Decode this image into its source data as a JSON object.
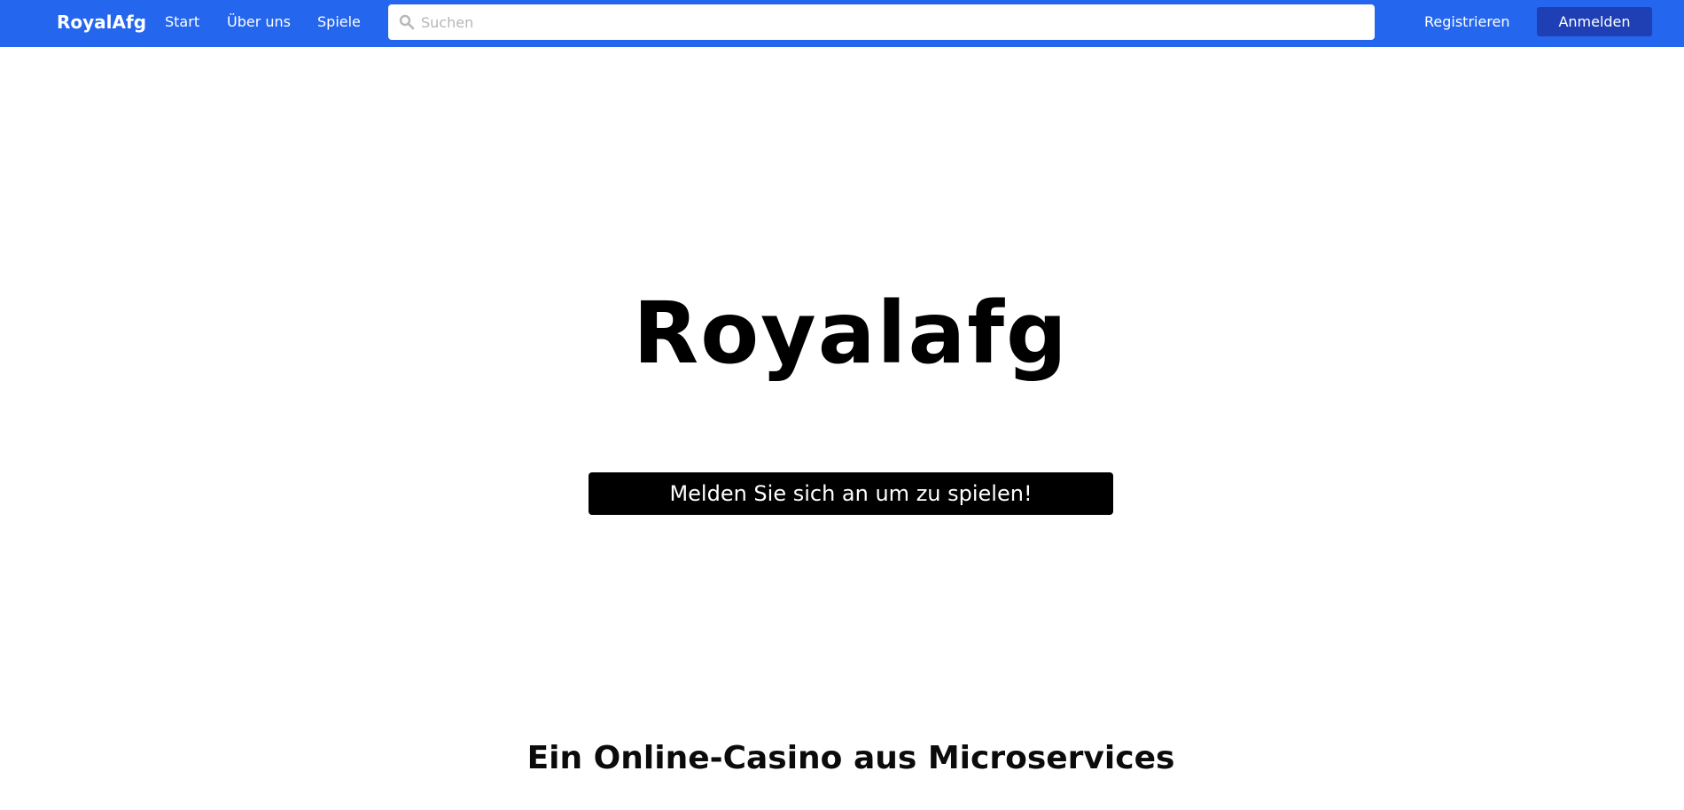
{
  "navbar": {
    "brand": "RoyalAfg",
    "links": [
      "Start",
      "Über uns",
      "Spiele"
    ],
    "search_placeholder": "Suchen",
    "search_value": "",
    "register_label": "Registrieren",
    "login_label": "Anmelden"
  },
  "hero": {
    "title": "Royalafg",
    "cta_label": "Melden Sie sich an um zu spielen!"
  },
  "section": {
    "title": "Ein Online-Casino aus Microservices"
  },
  "colors": {
    "navbar_bg": "#2466ed",
    "login_button_bg": "#1f3fb5",
    "cta_bg": "#000000",
    "text_on_primary": "#ffffff"
  },
  "icons": {
    "search": "search-icon"
  }
}
